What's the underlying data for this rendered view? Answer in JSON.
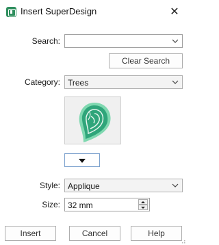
{
  "window": {
    "title": "Insert SuperDesign",
    "close_glyph": "✕",
    "app_icon": "superdesign-app-icon"
  },
  "search": {
    "label": "Search:",
    "value": "",
    "clear_button": "Clear Search"
  },
  "category": {
    "label": "Category:",
    "selected": "Trees"
  },
  "preview": {
    "design": "leaf-applique-thumbnail",
    "colors": {
      "fill": "#2fa57a",
      "outer": "#7fd8b0",
      "vein": "#e6f5ee"
    }
  },
  "style": {
    "label": "Style:",
    "selected": "Applique"
  },
  "size": {
    "label": "Size:",
    "value": "32 mm"
  },
  "buttons": {
    "insert": "Insert",
    "cancel": "Cancel",
    "help": "Help"
  },
  "colors": {
    "accent_border": "#7da2ce"
  }
}
